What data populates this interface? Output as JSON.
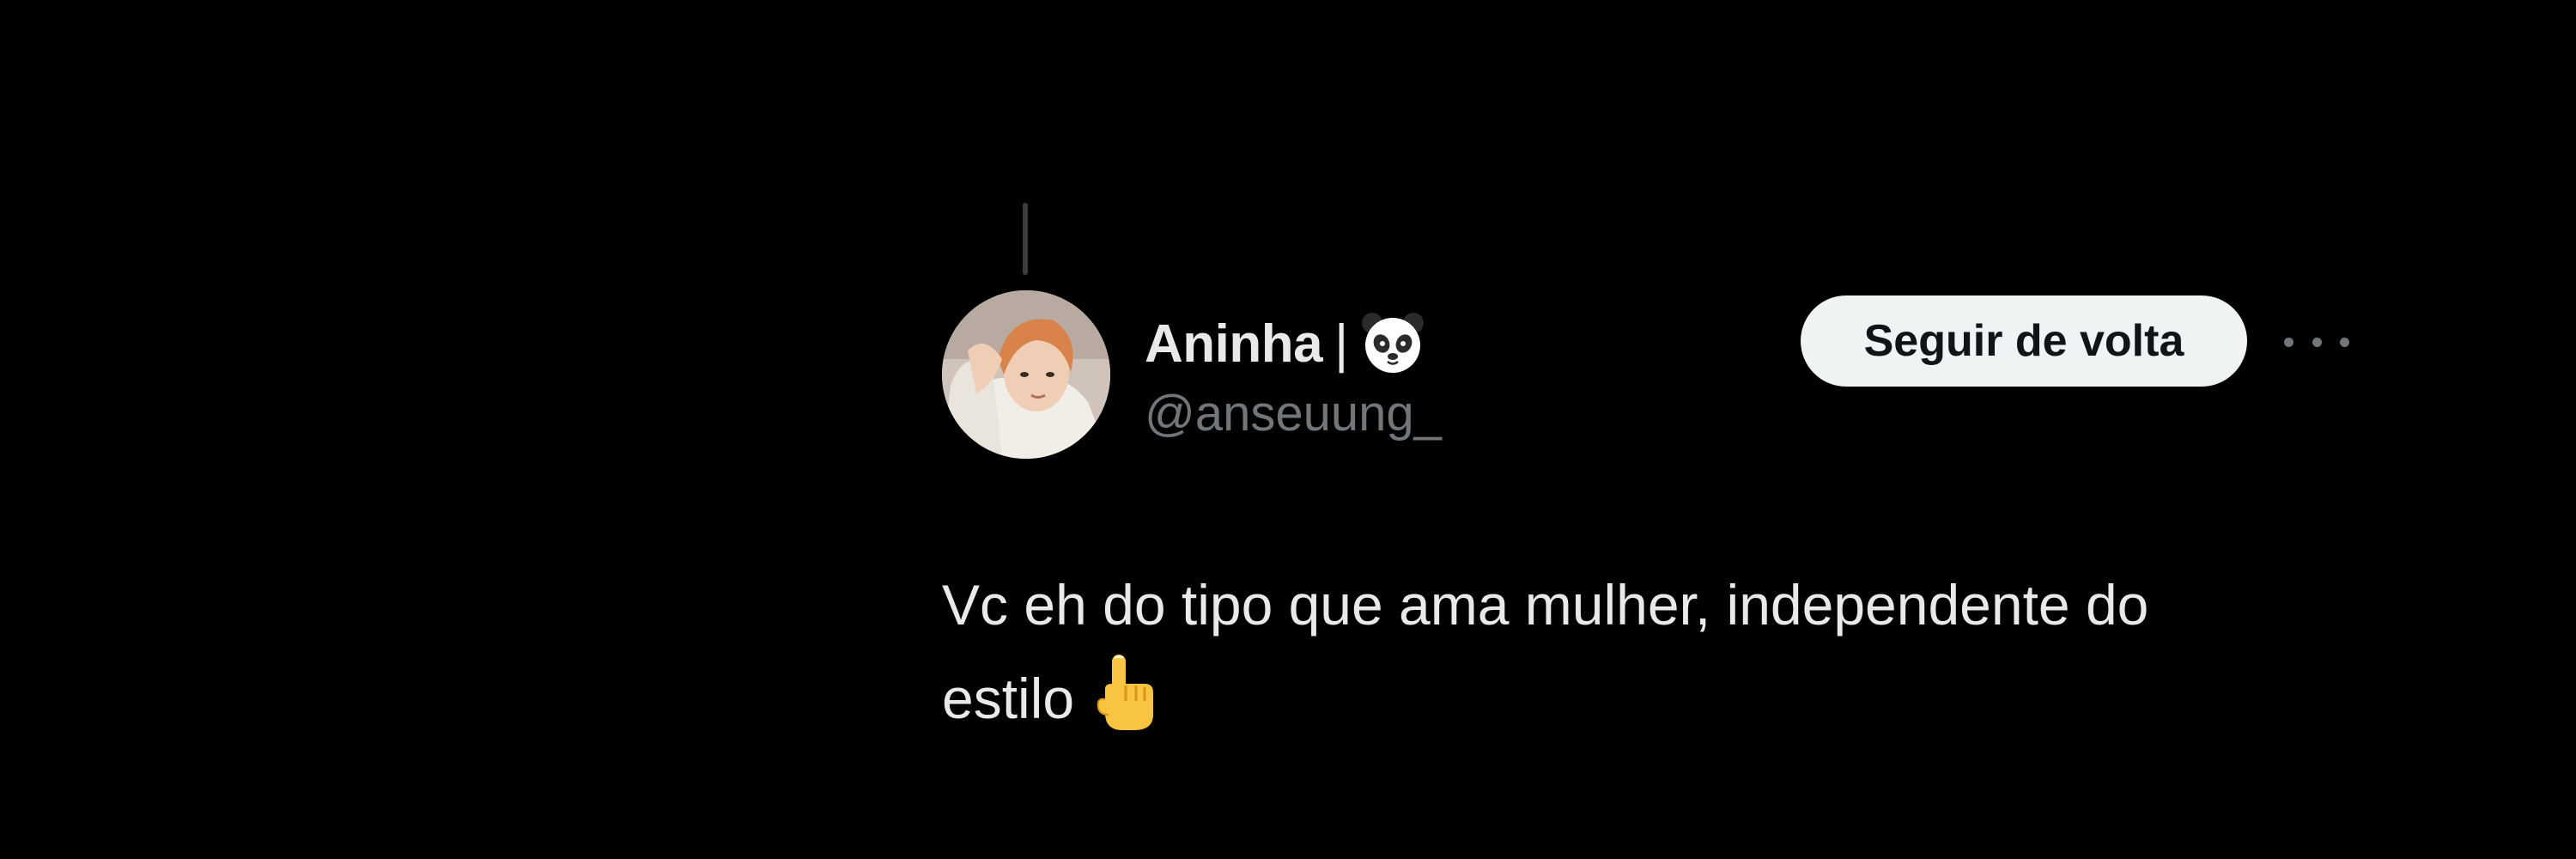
{
  "tweet": {
    "display_name": "Aninha",
    "name_separator": "|",
    "name_emoji": "panda-face-icon",
    "handle": "@anseuung_",
    "follow_button_label": "Seguir de volta",
    "more_icon": "more-horizontal-icon",
    "text_lines": [
      "Vc eh do tipo que ama mulher, independente do",
      "estilo"
    ],
    "text_emoji": "pointing-up-icon"
  },
  "colors": {
    "background": "#000000",
    "primary_text": "#e7e9ea",
    "secondary_text": "#71767b",
    "button_bg": "#eff3f4",
    "button_text": "#0f1419",
    "thread_line": "#3a3d40"
  }
}
